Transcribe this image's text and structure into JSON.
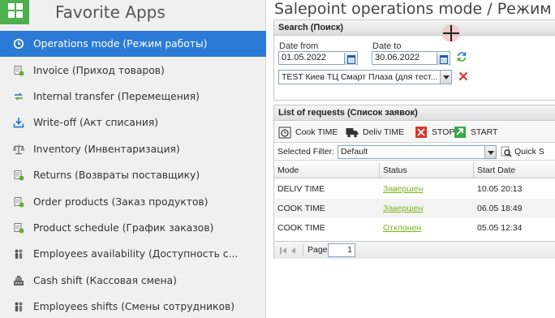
{
  "sidebar": {
    "title": "Favorite Apps",
    "items": [
      {
        "label": "Operations mode (Режим работы)",
        "icon": "clock-icon",
        "active": true
      },
      {
        "label": "Invoice (Приход товаров)",
        "icon": "document-icon"
      },
      {
        "label": "Internal transfer (Перемещения)",
        "icon": "transfer-arrows-icon"
      },
      {
        "label": "Write-off (Акт списания)",
        "icon": "download-tray-icon"
      },
      {
        "label": "Inventory (Инвентаризация)",
        "icon": "scales-icon"
      },
      {
        "label": "Returns (Возвраты поставщику)",
        "icon": "document-icon"
      },
      {
        "label": "Order products (Заказ продуктов)",
        "icon": "document-icon"
      },
      {
        "label": "Product schedule (График заказов)",
        "icon": "document-icon"
      },
      {
        "label": "Employees availability (Доступность с...",
        "icon": "people-icon"
      },
      {
        "label": "Cash shift (Кассовая смена)",
        "icon": "cash-register-icon"
      },
      {
        "label": "Employees shifts (Смены сотрудников)",
        "icon": "people-icon"
      }
    ]
  },
  "main": {
    "title": "Salepoint operations mode / Режим р",
    "search": {
      "header": "Search (Поиск)",
      "date_from_label": "Date from",
      "date_from_value": "01.05.2022",
      "date_to_label": "Date to",
      "date_to_value": "30.06.2022",
      "salepoint_value": "TEST Киев ТЦ Смарт Плаза (для тест..."
    },
    "requests": {
      "header": "List of requests (Список заявок)",
      "toolbar": {
        "cook_time": "Cook TIME",
        "deliv_time": "Deliv TIME",
        "stop": "STOP",
        "start": "START"
      },
      "filter_label": "Selected Filter:",
      "filter_value": "Default",
      "quick_search": "Quick S",
      "columns": [
        "Mode",
        "Status",
        "Start Date"
      ],
      "rows": [
        {
          "mode": "DELIV TIME",
          "status": "Завершен",
          "start_date": "10.05 20:13"
        },
        {
          "mode": "COOK TIME",
          "status": "Завершен",
          "start_date": "06.05 18:49"
        },
        {
          "mode": "COOK TIME",
          "status": "Отклонен",
          "start_date": "05.05 12:34"
        }
      ],
      "pager": {
        "page_label": "Page",
        "page_value": "1"
      }
    }
  },
  "colors": {
    "accent_active": "#2b7bd6",
    "app_grid": "#4caf50",
    "status_link": "#7ab51d",
    "stop_red": "#d9342b",
    "start_green": "#3aa84a"
  }
}
